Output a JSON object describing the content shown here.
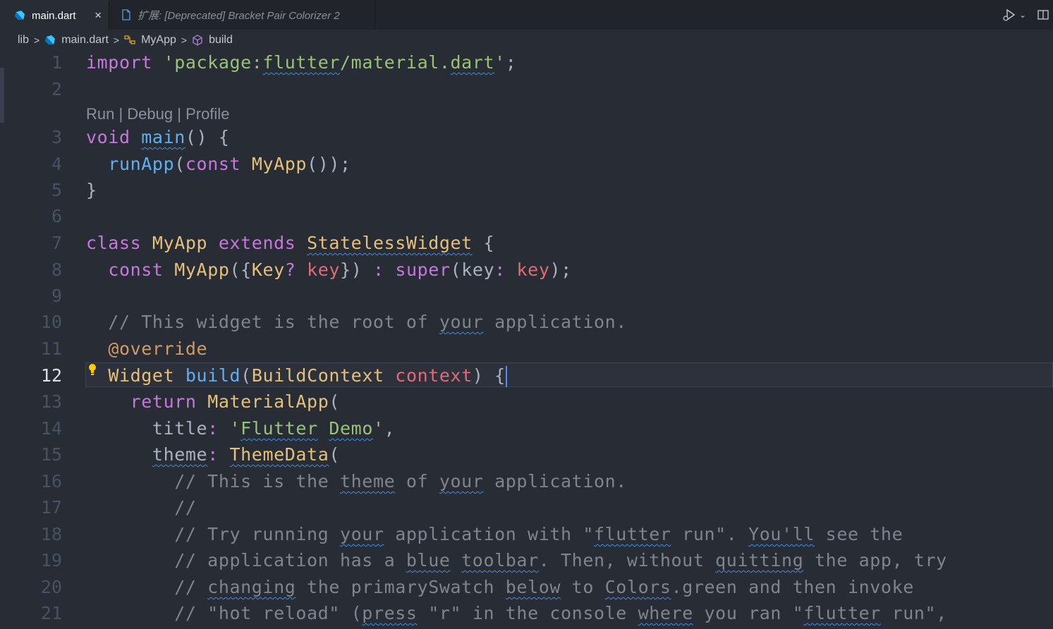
{
  "tabs": [
    {
      "label": "main.dart",
      "active": true,
      "icon": "dart-icon",
      "close": "×"
    },
    {
      "label": "扩展: [Deprecated] Bracket Pair Colorizer 2",
      "active": false,
      "icon": "file-icon"
    }
  ],
  "breadcrumb": [
    "lib",
    "main.dart",
    "MyApp",
    "build"
  ],
  "codelens": "Run | Debug | Profile",
  "current_line": 12,
  "colors": {
    "background": "#282c34",
    "keyword": "#c678dd",
    "string": "#98c379",
    "function": "#61afef",
    "type": "#e5c07b",
    "parameter": "#e06c75",
    "comment": "#7f848e",
    "annotation": "#d19a66"
  },
  "lines": [
    {
      "n": "1",
      "tokens": [
        [
          "kw",
          "import"
        ],
        [
          "pl",
          " "
        ],
        [
          "str",
          "'package:"
        ],
        [
          "str sq",
          "flutter"
        ],
        [
          "str",
          "/material."
        ],
        [
          "str sq",
          "dart"
        ],
        [
          "str",
          "'"
        ],
        [
          "pl",
          ";"
        ]
      ]
    },
    {
      "n": "2",
      "tokens": []
    },
    {
      "n": "3",
      "tokens": [
        [
          "kw",
          "void"
        ],
        [
          "pl",
          " "
        ],
        [
          "fn sq",
          "main"
        ],
        [
          "pl",
          "() {"
        ]
      ]
    },
    {
      "n": "4",
      "tokens": [
        [
          "pl",
          "  "
        ],
        [
          "fn",
          "runApp"
        ],
        [
          "pl",
          "("
        ],
        [
          "kw",
          "const"
        ],
        [
          "pl",
          " "
        ],
        [
          "ty",
          "MyApp"
        ],
        [
          "pl",
          "());"
        ]
      ]
    },
    {
      "n": "5",
      "tokens": [
        [
          "pl",
          "}"
        ]
      ]
    },
    {
      "n": "6",
      "tokens": []
    },
    {
      "n": "7",
      "tokens": [
        [
          "kw",
          "class"
        ],
        [
          "pl",
          " "
        ],
        [
          "ty",
          "MyApp"
        ],
        [
          "pl",
          " "
        ],
        [
          "kw",
          "extends"
        ],
        [
          "pl",
          " "
        ],
        [
          "ty sq",
          "StatelessWidget"
        ],
        [
          "pl",
          " {"
        ]
      ]
    },
    {
      "n": "8",
      "tokens": [
        [
          "pl",
          "  "
        ],
        [
          "kw",
          "const"
        ],
        [
          "pl",
          " "
        ],
        [
          "ty",
          "MyApp"
        ],
        [
          "pl",
          "({"
        ],
        [
          "ty",
          "Key"
        ],
        [
          "op",
          "?"
        ],
        [
          "pl",
          " "
        ],
        [
          "pr",
          "key"
        ],
        [
          "pl",
          "}) "
        ],
        [
          "op",
          ":"
        ],
        [
          "pl",
          " "
        ],
        [
          "kw",
          "super"
        ],
        [
          "pl",
          "(key"
        ],
        [
          "op",
          ":"
        ],
        [
          "pl",
          " "
        ],
        [
          "pr",
          "key"
        ],
        [
          "pl",
          ");"
        ]
      ]
    },
    {
      "n": "9",
      "tokens": []
    },
    {
      "n": "10",
      "tokens": [
        [
          "cm",
          "  // This widget is the root of "
        ],
        [
          "cm sq",
          "your"
        ],
        [
          "cm",
          " application."
        ]
      ]
    },
    {
      "n": "11",
      "tokens": [
        [
          "pl",
          "  "
        ],
        [
          "an",
          "@override"
        ]
      ]
    },
    {
      "n": "12",
      "tokens": [
        [
          "pl",
          "  "
        ],
        [
          "ty",
          "Widget"
        ],
        [
          "pl",
          " "
        ],
        [
          "fn",
          "build"
        ],
        [
          "pl",
          "("
        ],
        [
          "ty",
          "BuildContext"
        ],
        [
          "pl",
          " "
        ],
        [
          "pr",
          "context"
        ],
        [
          "pl",
          ") {"
        ]
      ]
    },
    {
      "n": "13",
      "tokens": [
        [
          "pl",
          "    "
        ],
        [
          "kw",
          "return"
        ],
        [
          "pl",
          " "
        ],
        [
          "ty",
          "MaterialApp"
        ],
        [
          "pl",
          "("
        ]
      ]
    },
    {
      "n": "14",
      "tokens": [
        [
          "pl",
          "      title"
        ],
        [
          "op",
          ":"
        ],
        [
          "pl",
          " "
        ],
        [
          "str",
          "'"
        ],
        [
          "str sq",
          "Flutter"
        ],
        [
          "str",
          " "
        ],
        [
          "str sq",
          "Demo"
        ],
        [
          "str",
          "'"
        ],
        [
          "pl",
          ","
        ]
      ]
    },
    {
      "n": "15",
      "tokens": [
        [
          "pl",
          "      "
        ],
        [
          "pl sq",
          "theme"
        ],
        [
          "op",
          ":"
        ],
        [
          "pl",
          " "
        ],
        [
          "ty sq",
          "ThemeData"
        ],
        [
          "pl",
          "("
        ]
      ]
    },
    {
      "n": "16",
      "tokens": [
        [
          "cm",
          "        // This is the "
        ],
        [
          "cm sq",
          "theme"
        ],
        [
          "cm",
          " of "
        ],
        [
          "cm sq",
          "your"
        ],
        [
          "cm",
          " application."
        ]
      ]
    },
    {
      "n": "17",
      "tokens": [
        [
          "cm",
          "        //"
        ]
      ]
    },
    {
      "n": "18",
      "tokens": [
        [
          "cm",
          "        // Try running "
        ],
        [
          "cm sq",
          "your"
        ],
        [
          "cm",
          " application with \""
        ],
        [
          "cm sq",
          "flutter"
        ],
        [
          "cm",
          " run\". "
        ],
        [
          "cm sq",
          "You'll"
        ],
        [
          "cm",
          " see the"
        ]
      ]
    },
    {
      "n": "19",
      "tokens": [
        [
          "cm",
          "        // application has a "
        ],
        [
          "cm sq",
          "blue"
        ],
        [
          "cm",
          " "
        ],
        [
          "cm sq",
          "toolbar"
        ],
        [
          "cm",
          ". Then, without "
        ],
        [
          "cm sq",
          "quitting"
        ],
        [
          "cm",
          " the app, try"
        ]
      ]
    },
    {
      "n": "20",
      "tokens": [
        [
          "cm",
          "        // "
        ],
        [
          "cm sq",
          "changing"
        ],
        [
          "cm",
          " the primarySwatch "
        ],
        [
          "cm sq",
          "below"
        ],
        [
          "cm",
          " to "
        ],
        [
          "cm sq",
          "Colors"
        ],
        [
          "cm",
          ".green and then invoke"
        ]
      ]
    },
    {
      "n": "21",
      "tokens": [
        [
          "cm",
          "        // \"hot reload\" ("
        ],
        [
          "cm sq",
          "press"
        ],
        [
          "cm",
          " \"r\" in the console "
        ],
        [
          "cm sq",
          "where"
        ],
        [
          "cm",
          " you ran \""
        ],
        [
          "cm sq",
          "flutter"
        ],
        [
          "cm",
          " run\","
        ]
      ]
    }
  ]
}
